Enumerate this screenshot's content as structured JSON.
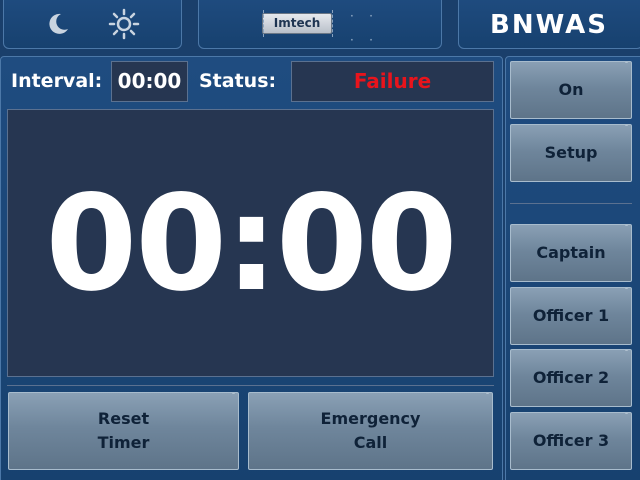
{
  "header": {
    "title": "BNWAS",
    "logo_text": "Imtech",
    "night_mode_icon": "moon-icon",
    "day_mode_icon": "sun-icon"
  },
  "status_bar": {
    "interval_label": "Interval:",
    "interval_value": "00:00",
    "status_label": "Status:",
    "status_value": "Failure",
    "status_color": "#e8141c"
  },
  "timer": {
    "display": "00:00"
  },
  "actions": {
    "reset_timer": "Reset\nTimer",
    "emergency_call": "Emergency\nCall"
  },
  "sidebar": {
    "on": "On",
    "setup": "Setup",
    "captain": "Captain",
    "officer_1": "Officer 1",
    "officer_2": "Officer 2",
    "officer_3": "Officer 3"
  },
  "colors": {
    "background": "#1a3f6b",
    "panel": "#263651",
    "button": "#6f869c",
    "text": "#ffffff"
  }
}
